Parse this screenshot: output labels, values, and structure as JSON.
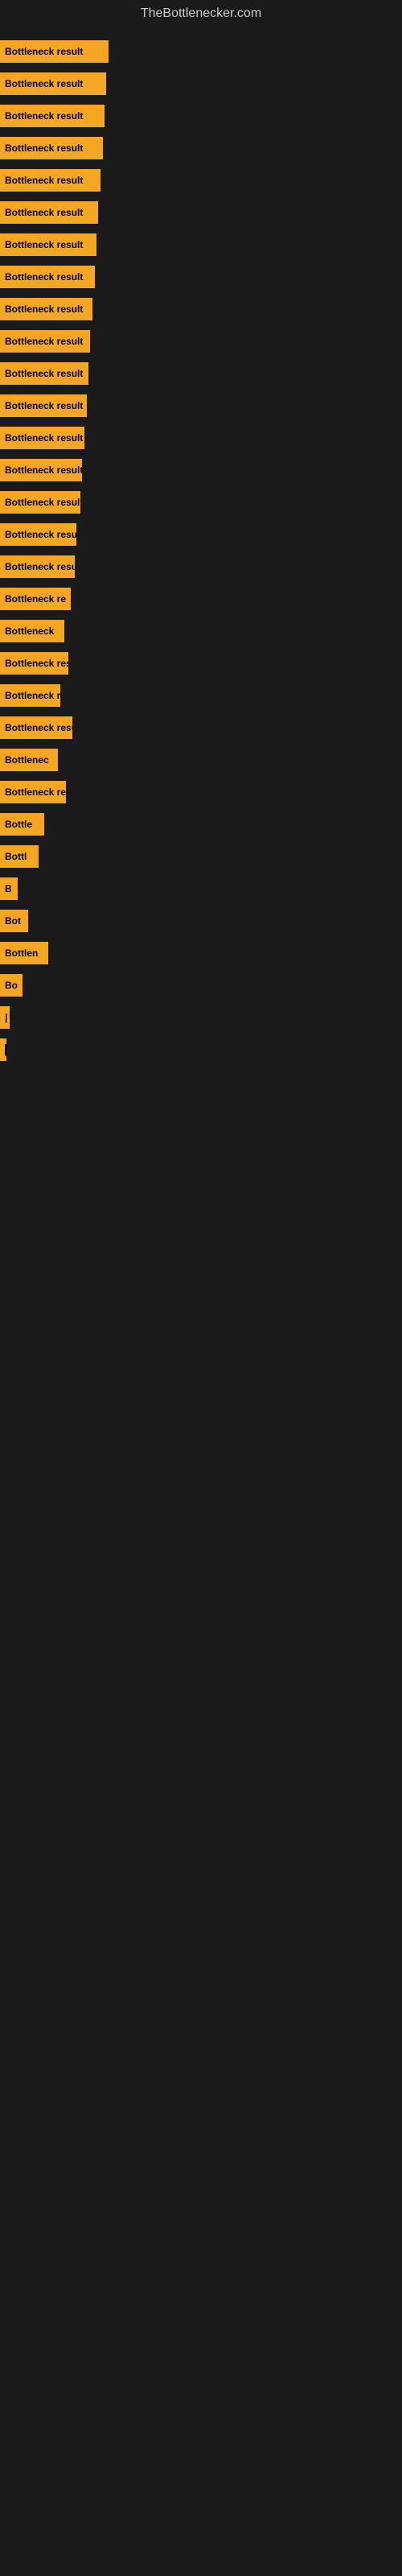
{
  "site": {
    "title": "TheBottlenecker.com"
  },
  "bars": [
    {
      "label": "Bottleneck result",
      "width": 135
    },
    {
      "label": "Bottleneck result",
      "width": 132
    },
    {
      "label": "Bottleneck result",
      "width": 130
    },
    {
      "label": "Bottleneck result",
      "width": 128
    },
    {
      "label": "Bottleneck result",
      "width": 125
    },
    {
      "label": "Bottleneck result",
      "width": 122
    },
    {
      "label": "Bottleneck result",
      "width": 120
    },
    {
      "label": "Bottleneck result",
      "width": 118
    },
    {
      "label": "Bottleneck result",
      "width": 115
    },
    {
      "label": "Bottleneck result",
      "width": 112
    },
    {
      "label": "Bottleneck result",
      "width": 110
    },
    {
      "label": "Bottleneck result",
      "width": 108
    },
    {
      "label": "Bottleneck result",
      "width": 105
    },
    {
      "label": "Bottleneck result",
      "width": 102
    },
    {
      "label": "Bottleneck result",
      "width": 100
    },
    {
      "label": "Bottleneck resu",
      "width": 95
    },
    {
      "label": "Bottleneck result",
      "width": 93
    },
    {
      "label": "Bottleneck re",
      "width": 88
    },
    {
      "label": "Bottleneck",
      "width": 80
    },
    {
      "label": "Bottleneck res",
      "width": 85
    },
    {
      "label": "Bottleneck r",
      "width": 75
    },
    {
      "label": "Bottleneck resu",
      "width": 90
    },
    {
      "label": "Bottlenec",
      "width": 72
    },
    {
      "label": "Bottleneck re",
      "width": 82
    },
    {
      "label": "Bottle",
      "width": 55
    },
    {
      "label": "Bottl",
      "width": 48
    },
    {
      "label": "B",
      "width": 22
    },
    {
      "label": "Bot",
      "width": 35
    },
    {
      "label": "Bottlen",
      "width": 60
    },
    {
      "label": "Bo",
      "width": 28
    },
    {
      "label": "|",
      "width": 12
    },
    {
      "label": "▌",
      "width": 8
    }
  ]
}
